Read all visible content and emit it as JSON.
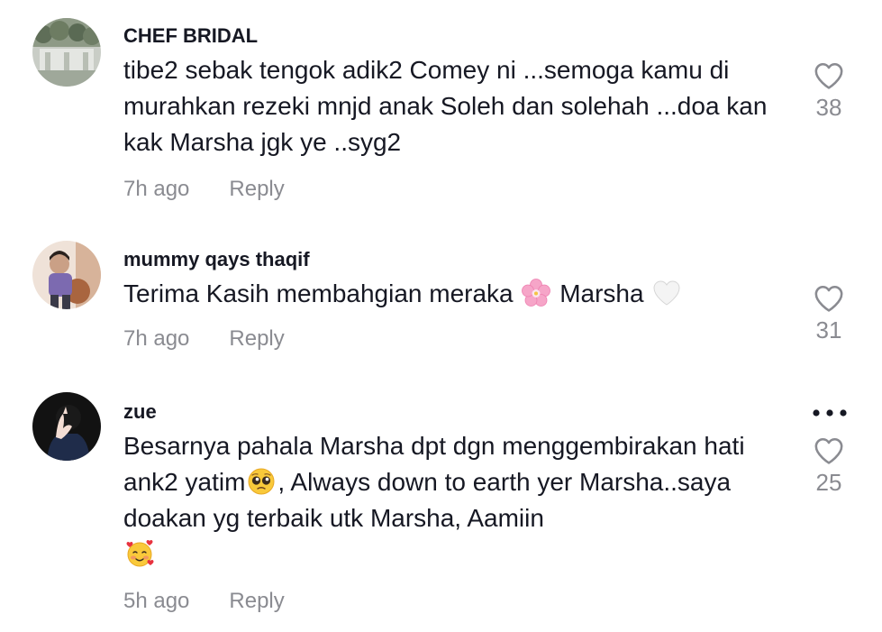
{
  "comments": [
    {
      "username": "CHEF BRIDAL",
      "text": "tibe2 sebak tengok adik2 Comey ni ...semoga kamu di murahkan rezeki mnjd anak Soleh dan solehah ...doa kan kak Marsha jgk ye ..syg2",
      "time": "7h ago",
      "reply_label": "Reply",
      "likes": "38",
      "avatar_icon": "wedding-hall-avatar"
    },
    {
      "username": "mummy qays thaqif",
      "text_before": "Terima Kasih membahgian meraka",
      "text_mid": "Marsha",
      "emoji_1": "cherry-blossom-emoji",
      "emoji_2": "white-heart-emoji",
      "time": "7h ago",
      "reply_label": "Reply",
      "likes": "31",
      "avatar_icon": "child-photo-avatar"
    },
    {
      "username": "zue",
      "text_before": "Besarnya pahala Marsha dpt dgn menggembirakan hati ank2 yatim",
      "text_after": ", Always down to earth yer Marsha..saya doakan yg terbaik utk Marsha, Aamiin",
      "emoji_1": "pleading-face-emoji",
      "emoji_2": "smiling-face-with-hearts-emoji",
      "time": "5h ago",
      "reply_label": "Reply",
      "likes": "25",
      "avatar_icon": "hijab-silhouette-avatar"
    }
  ],
  "icons": {
    "like": "heart-outline-icon",
    "more": "more-options-icon"
  },
  "colors": {
    "text": "#161823",
    "muted": "#8a8b91"
  }
}
